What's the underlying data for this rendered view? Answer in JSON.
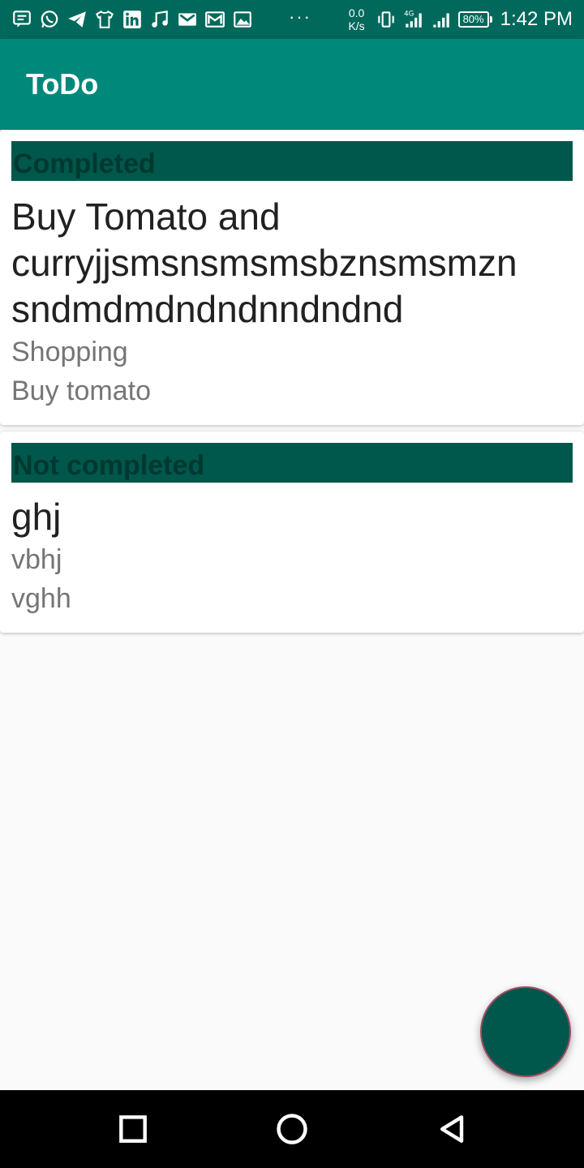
{
  "status_bar": {
    "notification_icons": [
      "message-icon",
      "whatsapp-icon",
      "telegram-icon",
      "tshirt-icon",
      "linkedin-icon",
      "music-icon",
      "gmail-icon",
      "gmail-icon",
      "image-icon"
    ],
    "more": "···",
    "net_speed_value": "0.0",
    "net_speed_unit": "K/s",
    "network": "4G",
    "battery": "80%",
    "time": "1:42 PM",
    "color": "#00695c"
  },
  "app_bar": {
    "title": "ToDo",
    "color": "#00897b"
  },
  "sections": {
    "completed": {
      "header": "Completed",
      "task": {
        "title": "Buy Tomato and curryjjsmsnsmsmsbznsmsmzn sndmdmdndndnndndnd",
        "category": "Shopping",
        "description": "Buy tomato"
      }
    },
    "not_completed": {
      "header": "Not completed",
      "task": {
        "title": "ghj",
        "category": "vbhj",
        "description": "vghh"
      }
    }
  },
  "colors": {
    "section_header": "#00574b",
    "fab": "#00574b",
    "fab_border": "#a34b63"
  },
  "nav_bar": {
    "buttons": [
      "recent-apps-icon",
      "home-icon",
      "back-icon"
    ]
  }
}
